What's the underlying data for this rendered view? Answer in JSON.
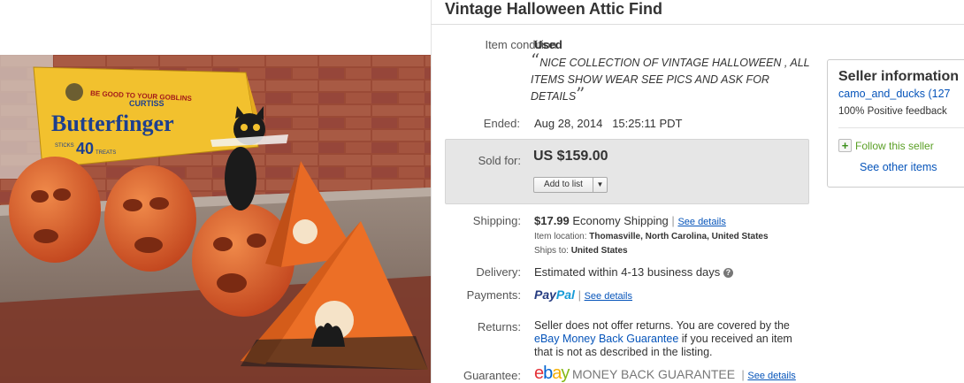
{
  "title": "Vintage Halloween Attic Find",
  "condition": {
    "label": "Item condition:",
    "value": "Used",
    "note": "NICE COLLECTION OF VINTAGE HALLOWEEN , ALL ITEMS SHOW WEAR SEE PICS AND ASK FOR DETAILS"
  },
  "ended": {
    "label": "Ended:",
    "date": "Aug 28, 2014",
    "time": "15:25:11 PDT"
  },
  "sold": {
    "label": "Sold for:",
    "price": "US $159.00",
    "add_to_list": "Add to list"
  },
  "shipping": {
    "label": "Shipping:",
    "cost": "$17.99",
    "service": "Economy Shipping",
    "see_details": "See details",
    "location_label": "Item location:",
    "location": "Thomasville, North Carolina, United States",
    "ships_to_label": "Ships to:",
    "ships_to": "United States"
  },
  "delivery": {
    "label": "Delivery:",
    "value": "Estimated within 4-13 business days"
  },
  "payments": {
    "label": "Payments:",
    "paypal_a": "Pay",
    "paypal_b": "Pal",
    "see_details": "See details"
  },
  "returns": {
    "label": "Returns:",
    "line1": "Seller does not offer returns. You are covered by the",
    "link": "eBay Money Back Guarantee",
    "line2_rest": " if you received an item",
    "line3": "that is not as described in the listing."
  },
  "guarantee": {
    "label": "Guarantee:",
    "e": "e",
    "b": "b",
    "a": "a",
    "y": "y",
    "text": "MONEY BACK GUARANTEE",
    "see_details": "See details"
  },
  "seller": {
    "heading": "Seller information",
    "name": "camo_and_ducks",
    "score": "(127",
    "feedback": "100% Positive feedback",
    "follow": "Follow this seller",
    "other": "See other items"
  },
  "photo": {
    "box_brand": "CURTISS",
    "box_product": "Butterfinger",
    "box_count": "40",
    "box_tagline": "BE GOOD TO YOUR GOBLINS",
    "box_small": "STICKS",
    "box_treats": "TREATS"
  },
  "colors": {
    "link": "#0654ba",
    "pumpkin": "#e0612a",
    "box_yellow": "#f2c12e",
    "brick": "#8b3a2b"
  }
}
